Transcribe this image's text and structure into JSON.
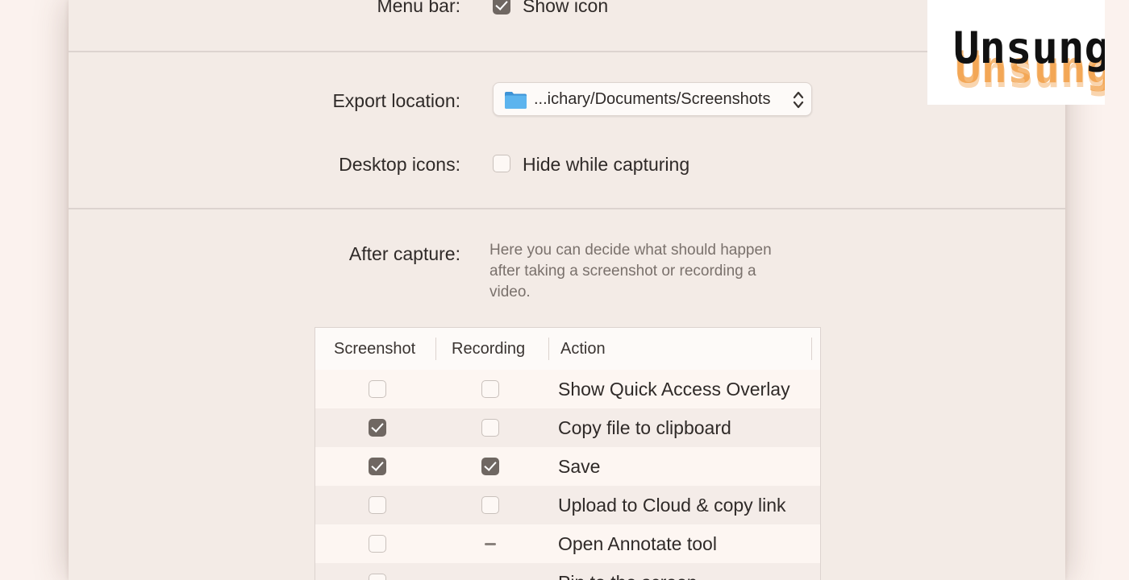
{
  "menu_bar": {
    "label": "Menu bar:",
    "option_label": "Show icon",
    "checked": true
  },
  "export_location": {
    "label": "Export location:",
    "path": "...ichary/Documents/Screenshots",
    "folder_icon": "folder-icon",
    "chevron_icon": "up-down-chevron-icon"
  },
  "desktop_icons": {
    "label": "Desktop icons:",
    "option_label": "Hide while capturing",
    "checked": false
  },
  "after_capture": {
    "label": "After capture:",
    "description": "Here you can decide what should happen after taking a screenshot or recording a video.",
    "columns": [
      "Screenshot",
      "Recording",
      "Action"
    ],
    "rows": [
      {
        "action": "Show Quick Access Overlay",
        "screenshot": "unchecked",
        "recording": "unchecked"
      },
      {
        "action": "Copy file to clipboard",
        "screenshot": "checked",
        "recording": "unchecked"
      },
      {
        "action": "Save",
        "screenshot": "checked",
        "recording": "checked"
      },
      {
        "action": "Upload to Cloud & copy link",
        "screenshot": "unchecked",
        "recording": "unchecked"
      },
      {
        "action": "Open Annotate tool",
        "screenshot": "unchecked",
        "recording": "unavailable"
      },
      {
        "action": "Pin to the screen",
        "screenshot": "unchecked",
        "recording": "unavailable"
      }
    ]
  },
  "watermark": {
    "text": "Unsung",
    "text_color": "#111111",
    "accent_color": "#f08a1c"
  },
  "colors": {
    "window_bg": "#f3ebe6",
    "outer_bg": "#fbf2ee",
    "checkbox_checked": "#6f6762",
    "folder_blue": "#4aa6e6"
  }
}
